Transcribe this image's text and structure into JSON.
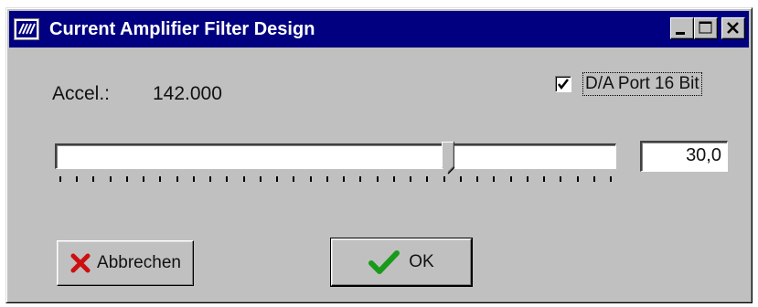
{
  "window": {
    "title": "Current Amplifier Filter Design",
    "app_icon": "app-logo-icon",
    "controls": [
      "minimize-icon",
      "maximize-icon",
      "close-icon"
    ]
  },
  "accel": {
    "label": "Accel.:",
    "value": "142.000"
  },
  "checkbox": {
    "label": "D/A Port 16 Bit",
    "checked": true
  },
  "slider": {
    "position_fraction": 0.7,
    "tick_count": 34
  },
  "value_field": {
    "value": "30,0"
  },
  "buttons": {
    "cancel": {
      "label": "Abbrechen",
      "icon": "x-icon",
      "icon_color": "#cc1010"
    },
    "ok": {
      "label": "OK",
      "icon": "check-icon",
      "icon_color": "#1a9a1a"
    }
  },
  "colors": {
    "titlebar": "#000080",
    "face": "#c0c0c0"
  }
}
